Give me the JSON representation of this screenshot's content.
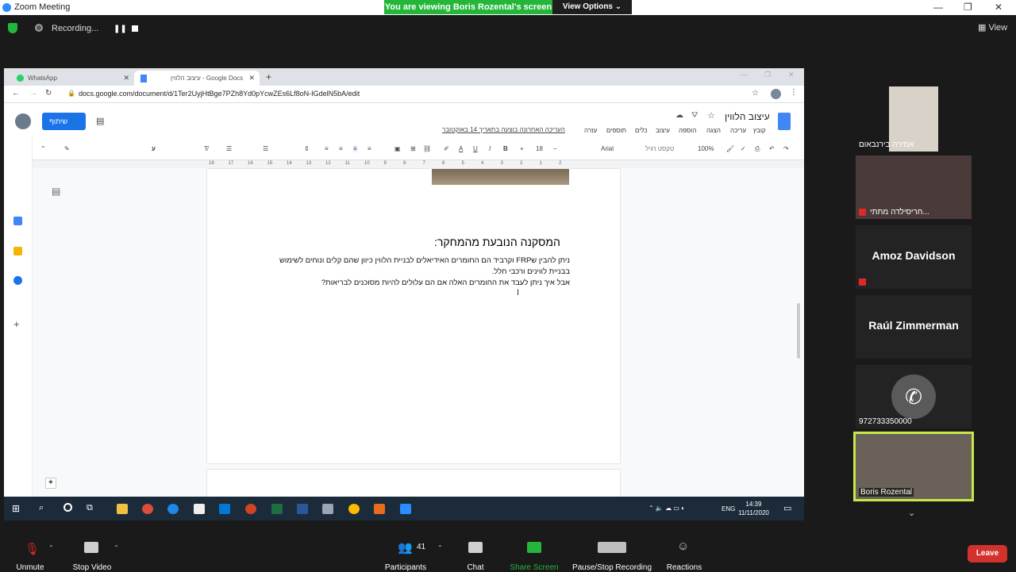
{
  "zoom": {
    "window_title": "Zoom Meeting",
    "banner": "You are viewing Boris Rozental's screen",
    "view_options": "View Options ⌄",
    "recording": "Recording...",
    "view": "View"
  },
  "browser": {
    "tabs": [
      {
        "label": "WhatsApp"
      },
      {
        "label": "עיצוב הלווין - Google Docs"
      }
    ],
    "url": "docs.google.com/document/d/1Ter2UyjHtBge7PZh8Yd0pYcwZEs6Lf8oN-IGdelN5bA/edit"
  },
  "docs": {
    "share_label": "שיתוף",
    "title": "עיצוב הלווין",
    "menu": [
      "קובץ",
      "עריכה",
      "הצגה",
      "הוספה",
      "עיצוב",
      "כלים",
      "תוספים",
      "עזרה"
    ],
    "last_edit": "העריכה האחרונה בוצעה בתאריך 14 באוקטובר",
    "toolbar": {
      "zoom": "100%",
      "style": "טקסט רגיל",
      "font": "Arial",
      "size": "18"
    },
    "ruler": [
      "18",
      "17",
      "16",
      "15",
      "14",
      "13",
      "12",
      "11",
      "10",
      "9",
      "8",
      "7",
      "6",
      "5",
      "4",
      "3",
      "2",
      "1",
      "2"
    ],
    "heading": "המסקנה הנובעת מהמחקר:",
    "para1": "ניתן להבין שFRP וקרביד הם החומרים האידיאלים לבניית הלווין כיוון שהם קלים ונוחים לשימוש",
    "para2": "בבניית לווינים ורכבי חלל.",
    "para3": "אבל איך ניתן לעבד את החומרים האלה אם הם עלולים להיות מסוכנים לבריאות?"
  },
  "taskbar": {
    "lang": "ENG",
    "time": "14:39",
    "date": "11/11/2020"
  },
  "participants": [
    {
      "name": "אמירה בירנבאום",
      "type": "video"
    },
    {
      "name": "חריסילדה מתתי...",
      "type": "video"
    },
    {
      "name": "Amoz Davidson",
      "type": "name"
    },
    {
      "name": "Raúl Zimmerman",
      "type": "name"
    },
    {
      "name": "972733350000",
      "type": "phone"
    },
    {
      "name": "Boris Rozental",
      "type": "video"
    }
  ],
  "controls": {
    "unmute": "Unmute",
    "stop_video": "Stop Video",
    "participants": "Participants",
    "participants_count": "41",
    "chat": "Chat",
    "share_screen": "Share Screen",
    "pause_recording": "Pause/Stop Recording",
    "reactions": "Reactions",
    "leave": "Leave"
  },
  "colors": {
    "share_green": "#23b63a",
    "leave_red": "#d3312c",
    "docs_blue": "#1a73e8"
  }
}
